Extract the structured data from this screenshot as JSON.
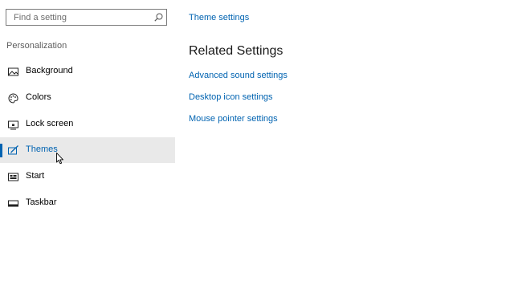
{
  "search": {
    "placeholder": "Find a setting",
    "icon": "search-icon"
  },
  "sidebar": {
    "section_label": "Personalization",
    "items": [
      {
        "label": "Background",
        "icon": "background-image-icon",
        "selected": false
      },
      {
        "label": "Colors",
        "icon": "palette-icon",
        "selected": false
      },
      {
        "label": "Lock screen",
        "icon": "lock-screen-icon",
        "selected": false
      },
      {
        "label": "Themes",
        "icon": "themes-brush-icon",
        "selected": true
      },
      {
        "label": "Start",
        "icon": "start-menu-icon",
        "selected": false
      },
      {
        "label": "Taskbar",
        "icon": "taskbar-icon",
        "selected": false
      }
    ]
  },
  "content": {
    "top_link": "Theme settings",
    "related_heading": "Related Settings",
    "related_links": [
      "Advanced sound settings",
      "Desktop icon settings",
      "Mouse pointer settings"
    ]
  },
  "colors": {
    "accent": "#0063b1",
    "selected_background": "#e9e9e9"
  }
}
